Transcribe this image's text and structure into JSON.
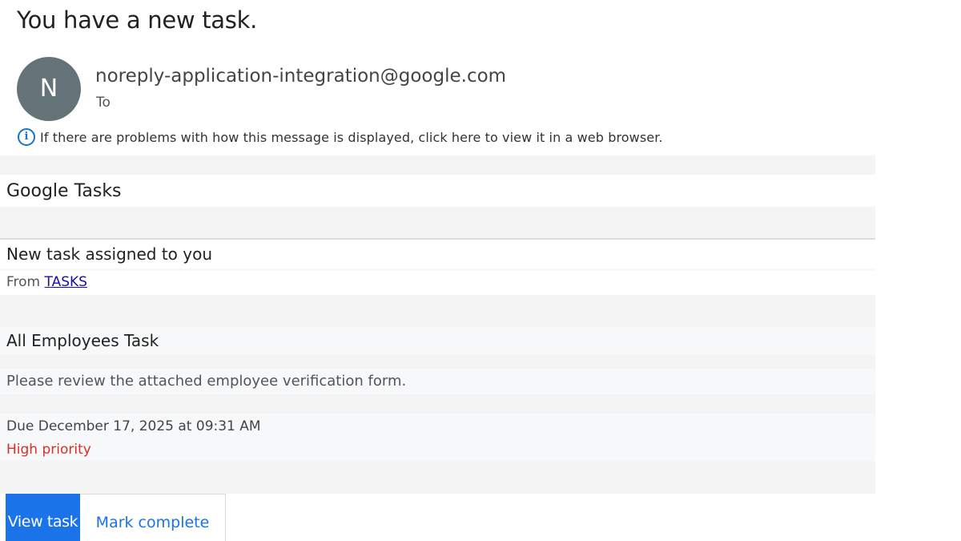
{
  "header": {
    "subject": "You have a new task.",
    "avatar_letter": "N",
    "sender": "noreply-application-integration@google.com",
    "to_label": "To",
    "info_text": "If there are problems with how this message is displayed, click here to view it in a web browser."
  },
  "body": {
    "service_title": "Google Tasks",
    "notice_title": "New task assigned to you",
    "from_label": "From",
    "from_link": "TASKS",
    "task_title": "All Employees Task",
    "task_description": "Please review the attached employee verification form.",
    "due_text": "Due December 17, 2025 at 09:31 AM",
    "priority_text": "High priority",
    "view_button": "View task",
    "mark_button": "Mark complete"
  },
  "colors": {
    "avatar": "#637378",
    "link": "#1a0dab",
    "primary_button": "#1a73e8",
    "priority": "#d93025"
  },
  "icons": {
    "info": "info-circle-icon"
  }
}
